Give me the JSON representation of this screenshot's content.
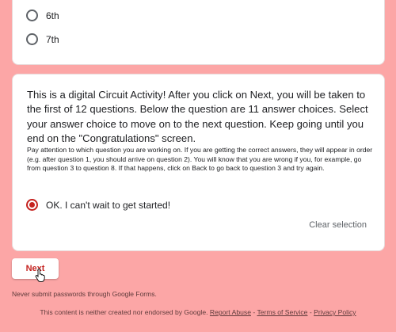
{
  "options_top": [
    {
      "label": "6th",
      "checked": false
    },
    {
      "label": "7th",
      "checked": false
    }
  ],
  "description": {
    "main": "This is a digital Circuit Activity! After you click on Next, you will be taken to the first of 12 questions. Below the question are 11 answer choices. Select your answer choice to move on to the next question. Keep going until you end on the \"Congratulations\" screen.",
    "note": "Pay attention to which question you are working on. If you are getting the correct answers, they will appear in order (e.g. after question 1, you should arrive on question 2). You will know that you are wrong if you, for example, go from question 3 to question 8. If that happens, click on Back to go back to question 3 and try again."
  },
  "start_option": {
    "label": "OK. I can't wait to get started!",
    "checked": true
  },
  "clear_selection": "Clear selection",
  "next_button": "Next",
  "never_submit": "Never submit passwords through Google Forms.",
  "footer": {
    "text": "This content is neither created nor endorsed by Google.",
    "report": "Report Abuse",
    "sep1": " - ",
    "terms": "Terms of Service",
    "sep2": " - ",
    "privacy": "Privacy Policy"
  },
  "colors": {
    "background": "#fca6a6",
    "accent": "#c5221f",
    "card": "#ffffff"
  },
  "icons": {
    "cursor": "hand-pointer-icon"
  }
}
